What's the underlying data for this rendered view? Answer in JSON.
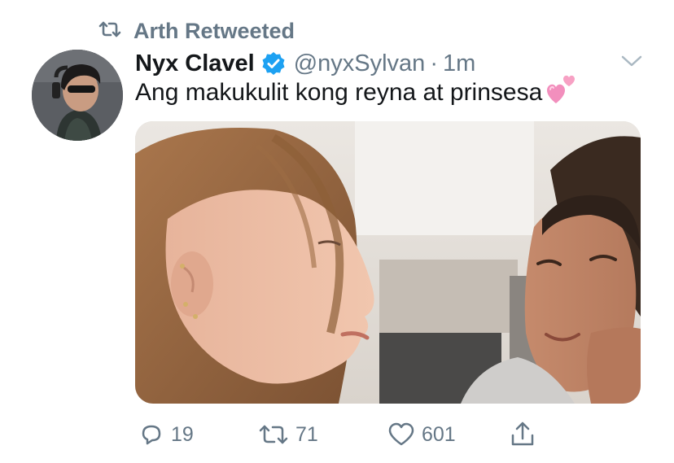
{
  "retweet_context": {
    "icon": "retweet-icon",
    "label": "Arth Retweeted"
  },
  "tweet": {
    "author": {
      "display_name": "Nyx Clavel",
      "verified": true,
      "handle": "@nyxSylvan",
      "avatar_icon": "avatar"
    },
    "separator": "·",
    "timestamp": "1m",
    "text": "Ang makukulit kong reyna at prinsesa",
    "emoji": "two-hearts-emoji",
    "media": {
      "type": "photo",
      "description_icon": "photo"
    },
    "actions": {
      "reply": {
        "icon": "reply-icon",
        "count": "19"
      },
      "retweet": {
        "icon": "retweet-icon",
        "count": "71"
      },
      "like": {
        "icon": "heart-icon",
        "count": "601"
      },
      "share": {
        "icon": "share-icon"
      }
    }
  },
  "colors": {
    "text_primary": "#14171a",
    "text_secondary": "#657786",
    "verified_blue": "#1da1f2",
    "emoji_pink": "#f5a3c7"
  }
}
